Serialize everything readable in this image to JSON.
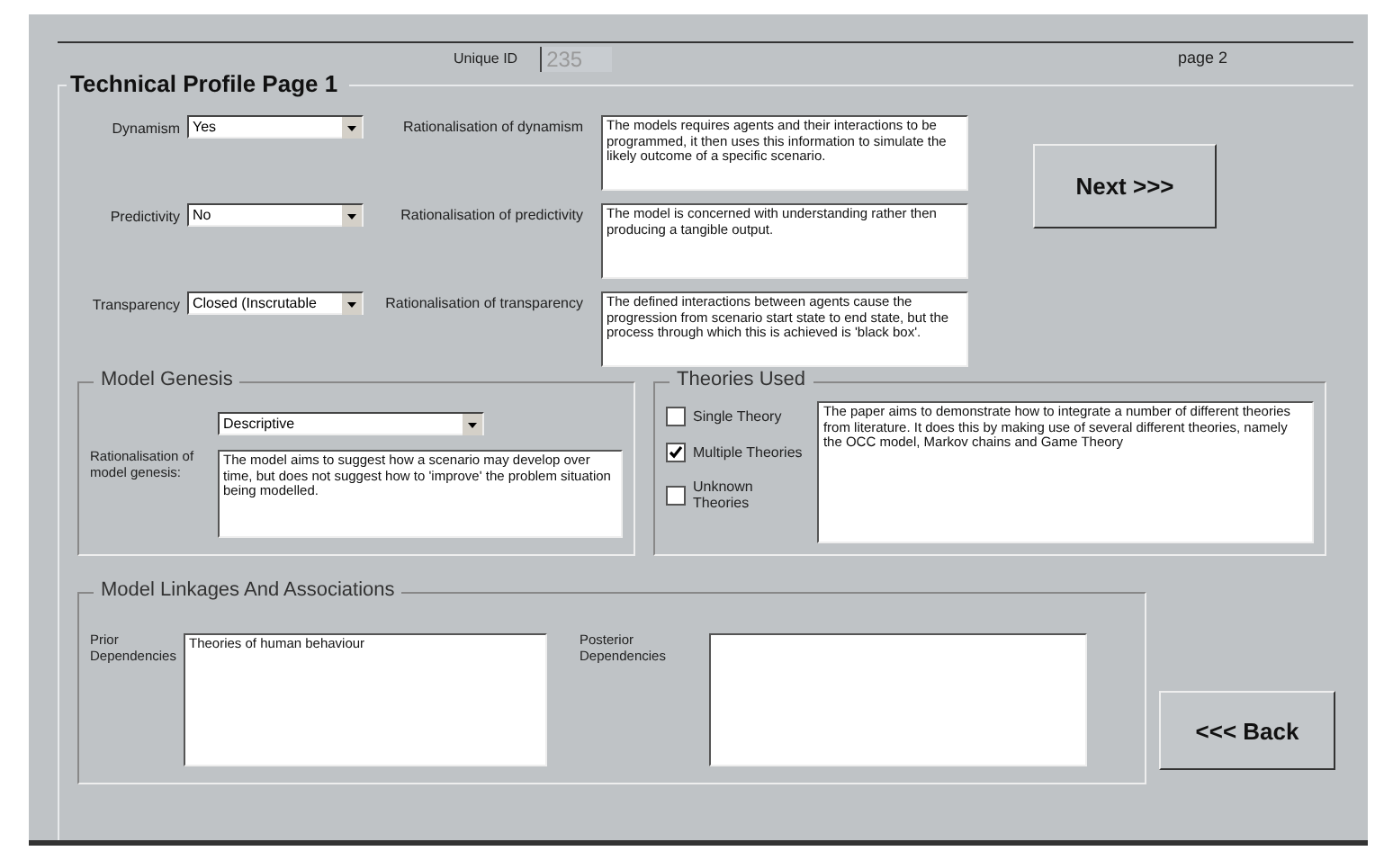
{
  "header": {
    "unique_id_label": "Unique ID",
    "unique_id": "235",
    "page": "page 2"
  },
  "title": "Technical Profile Page 1",
  "attributes": [
    {
      "label": "Dynamism",
      "value": "Yes",
      "rationale_label": "Rationalisation of dynamism",
      "rationale": "The models requires agents and their interactions to be programmed, it then uses this information to simulate the likely outcome of a specific scenario."
    },
    {
      "label": "Predictivity",
      "value": "No",
      "rationale_label": "Rationalisation of predictivity",
      "rationale": "The model is concerned with understanding rather then producing a tangible output."
    },
    {
      "label": "Transparency",
      "value": "Closed (Inscrutable",
      "rationale_label": "Rationalisation of transparency",
      "rationale": "The defined interactions between agents cause the progression from scenario start state to end state, but the process through which this is achieved is 'black box'."
    }
  ],
  "buttons": {
    "next": "Next >>>",
    "back": "<<< Back"
  },
  "model_genesis": {
    "title": "Model Genesis",
    "value": "Descriptive",
    "rationale_label": "Rationalisation of model genesis:",
    "rationale": "The model aims to suggest how a scenario may develop over time, but does not suggest how to 'improve' the problem situation being modelled."
  },
  "theories_used": {
    "title": "Theories Used",
    "options": [
      {
        "label": "Single Theory",
        "checked": false
      },
      {
        "label": "Multiple Theories",
        "checked": true
      },
      {
        "label": "Unknown Theories",
        "checked": false
      }
    ],
    "description": "The paper aims to demonstrate how to integrate a number of different theories from literature. It does this by making use of several different theories, namely the OCC model, Markov chains and Game Theory"
  },
  "linkages": {
    "title": "Model Linkages And Associations",
    "prior_label": "Prior Dependencies",
    "prior": "Theories of human behaviour",
    "posterior_label": "Posterior Dependencies"
  }
}
